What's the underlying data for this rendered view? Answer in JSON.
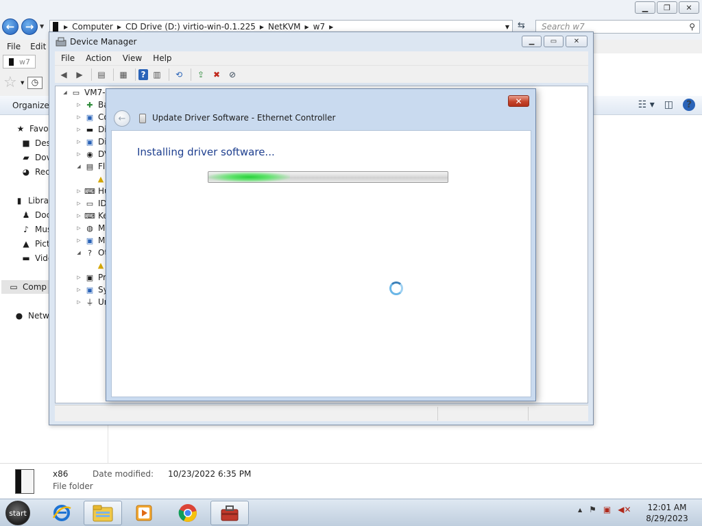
{
  "explorer": {
    "address_crumbs": [
      "Computer",
      "CD Drive (D:) virtio-win-0.1.225",
      "NetKVM",
      "w7"
    ],
    "search_placeholder": "Search w7",
    "menu": [
      "File",
      "Edit"
    ],
    "tab_label": "w7",
    "organize_label": "Organize",
    "nav": {
      "favorites": "Favor",
      "desktop": "Des",
      "downloads": "Dov",
      "recent": "Rec",
      "libraries": "Librar",
      "documents": "Doc",
      "music": "Mus",
      "pictures": "Pict",
      "videos": "Vide",
      "computer": "Comp",
      "network": "Netwo"
    },
    "details": {
      "name": "x86",
      "modified_label": "Date modified:",
      "modified_value": "10/23/2022 6:35 PM",
      "type": "File folder"
    }
  },
  "device_manager": {
    "title": "Device Manager",
    "menu": [
      "File",
      "Action",
      "View",
      "Help"
    ],
    "tree_root": "VM7-",
    "tree_items": [
      "Ba",
      "Co",
      "Di",
      "Di",
      "DV",
      "Fl",
      "Hu",
      "ID",
      "Ke",
      "M",
      "M",
      "Ot",
      "Pr",
      "Sy",
      "Ur"
    ]
  },
  "dialog": {
    "title": "Update Driver Software - Ethernet Controller",
    "heading": "Installing driver software...",
    "progress_fraction": 0.3
  },
  "taskbar": {
    "start_label": "start",
    "time": "12:01 AM",
    "date": "8/29/2023"
  },
  "colors": {
    "dialog_heading": "#1e3f8f",
    "progress_glow": "#27d13a",
    "close_button": "#c6442b"
  }
}
